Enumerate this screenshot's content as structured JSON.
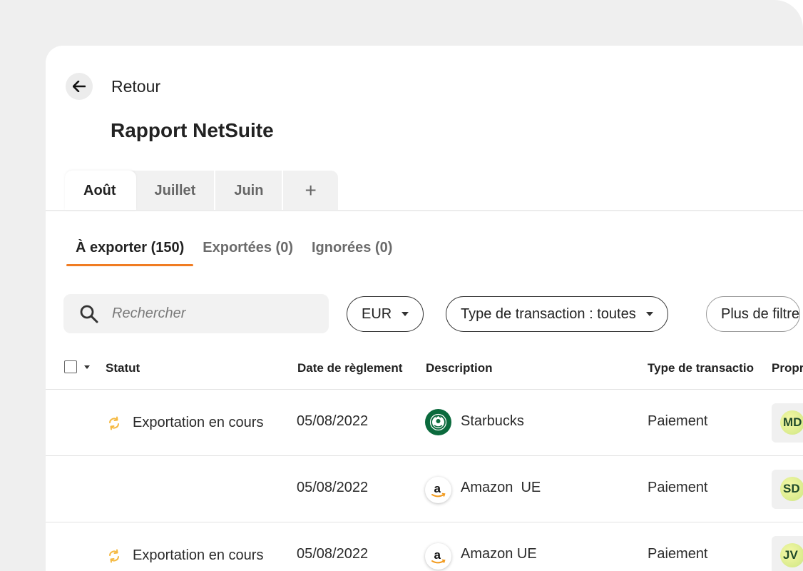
{
  "header": {
    "back_label": "Retour",
    "title": "Rapport NetSuite"
  },
  "month_tabs": [
    {
      "label": "Août",
      "active": true
    },
    {
      "label": "Juillet",
      "active": false
    },
    {
      "label": "Juin",
      "active": false
    },
    {
      "label": "+",
      "active": false
    }
  ],
  "sub_tabs": [
    {
      "label": "À exporter (150)",
      "active": true
    },
    {
      "label": "Exportées (0)",
      "active": false
    },
    {
      "label": "Ignorées (0)",
      "active": false
    }
  ],
  "filters": {
    "search_placeholder": "Rechercher",
    "search_value": "",
    "currency": "EUR",
    "transaction_type": "Type de transaction : toutes",
    "more_filters": "Plus de filtre"
  },
  "table": {
    "columns": {
      "status": "Statut",
      "date": "Date de règlement",
      "description": "Description",
      "type": "Type de transactio",
      "owner": "Propr"
    },
    "rows": [
      {
        "status": "Exportation en cours",
        "date": "05/08/2022",
        "description": "Starbucks",
        "logo": "starbucks-logo",
        "type": "Paiement",
        "owner_initials": "MD"
      },
      {
        "status": "",
        "date": "05/08/2022",
        "description": "Amazon  UE",
        "logo": "amazon-logo",
        "type": "Paiement",
        "owner_initials": "SD"
      },
      {
        "status": "Exportation en cours",
        "date": "05/08/2022",
        "description": "Amazon UE",
        "logo": "amazon-logo",
        "type": "Paiement",
        "owner_initials": "JV"
      }
    ]
  },
  "colors": {
    "accent": "#f07c22",
    "status_icon": "#f5b941",
    "avatar": "#e2ef95"
  },
  "icons": {
    "back": "arrow-left-icon",
    "search": "search-icon",
    "status": "sync-icon"
  }
}
